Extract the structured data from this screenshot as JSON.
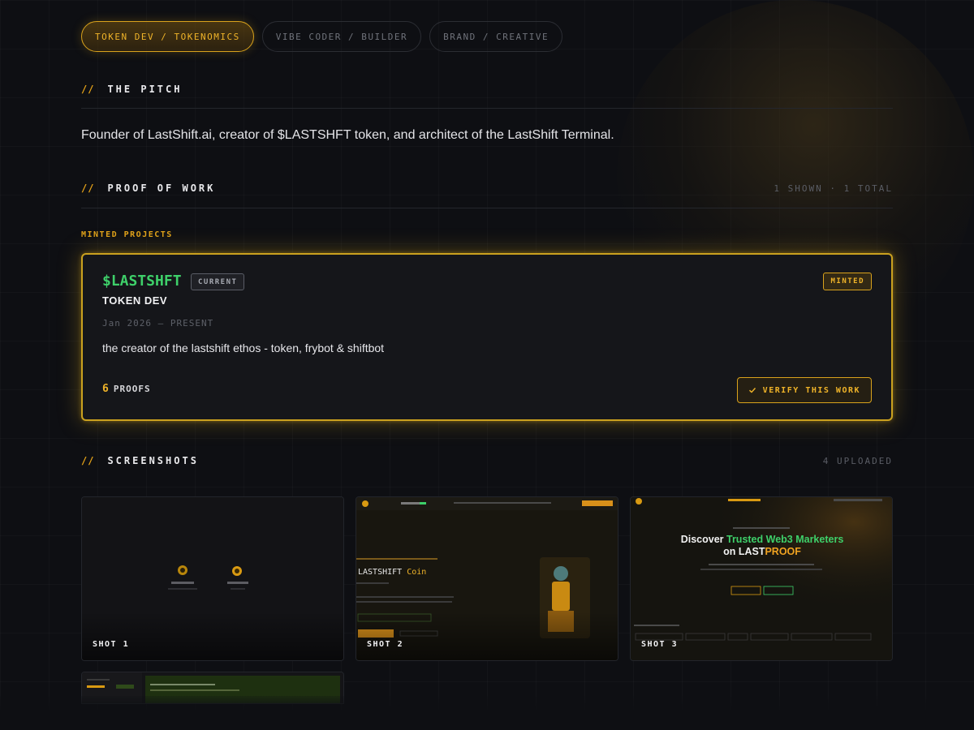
{
  "tabs": [
    {
      "label": "TOKEN DEV / TOKENOMICS",
      "active": true
    },
    {
      "label": "VIBE CODER / BUILDER",
      "active": false
    },
    {
      "label": "BRAND / CREATIVE",
      "active": false
    }
  ],
  "pitch": {
    "prefix": "//",
    "title": "THE PITCH",
    "text": "Founder of LastShift.ai, creator of $LASTSHFT token, and architect of the LastShift Terminal."
  },
  "proof_of_work": {
    "prefix": "//",
    "title": "PROOF OF WORK",
    "meta": "1 SHOWN · 1 TOTAL",
    "group_label": "MINTED PROJECTS",
    "card": {
      "ticker": "$LASTSHFT",
      "badge_current": "CURRENT",
      "badge_minted": "MINTED",
      "role": "TOKEN DEV",
      "dates": "Jan 2026 — PRESENT",
      "description": "the creator of the lastshift ethos - token, frybot & shiftbot",
      "proofs_count": "6",
      "proofs_label": "PROOFS",
      "verify_label": "VERIFY THIS WORK",
      "verify_icon": "check-icon"
    }
  },
  "screenshots": {
    "prefix": "//",
    "title": "SCREENSHOTS",
    "meta": "4 UPLOADED",
    "items": [
      {
        "caption": "SHOT 1"
      },
      {
        "caption": "SHOT 2",
        "heading": "LASTSHIFT",
        "heading_accent": "Coin"
      },
      {
        "caption": "SHOT 3",
        "headline_line1": "Discover",
        "headline_accent": "Trusted Web3 Marketers",
        "headline_line2": "on LAST",
        "headline_accent2": "PROOF"
      }
    ]
  },
  "colors": {
    "accent": "#f0b429",
    "accent_border": "#d9a21c",
    "ticker_green": "#3ed06a",
    "background": "#0e0f13"
  }
}
